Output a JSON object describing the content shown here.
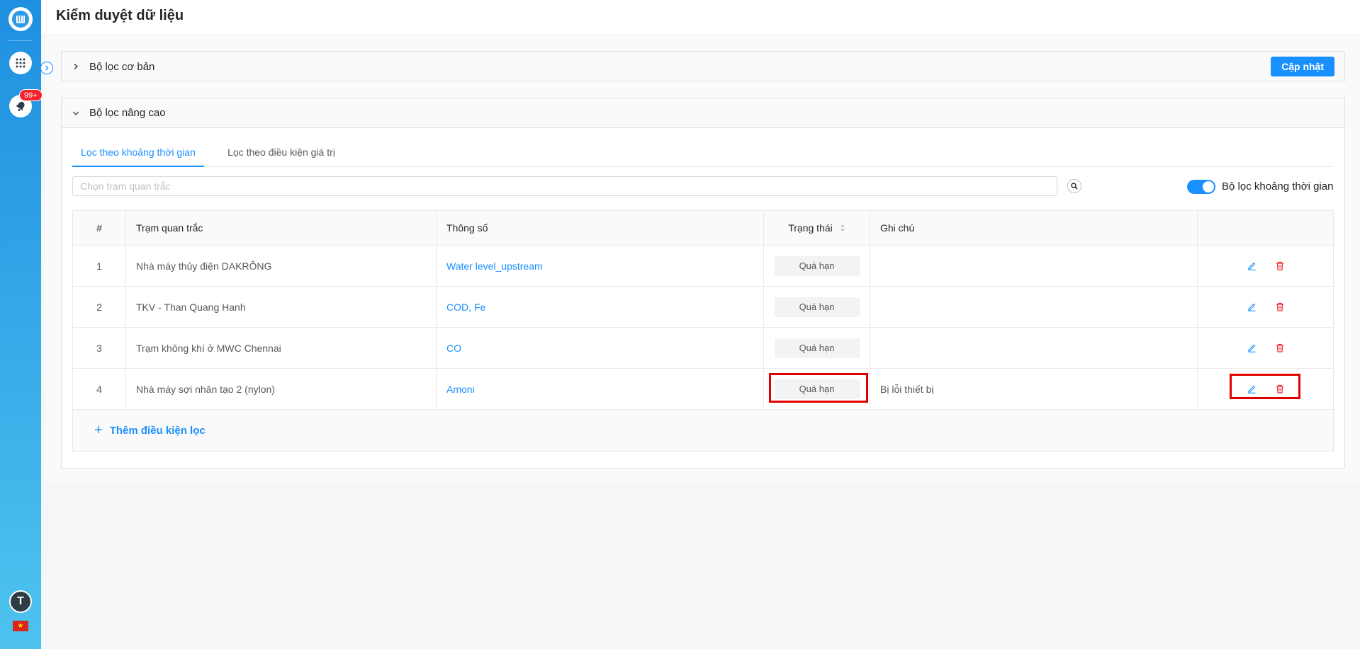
{
  "header": {
    "title": "Kiểm duyệt dữ liệu"
  },
  "sidebar": {
    "notification_count": "99+",
    "avatar_letter": "T"
  },
  "filters": {
    "basic_title": "Bộ lọc cơ bản",
    "update_label": "Cập nhật",
    "advanced_title": "Bộ lọc nâng cao",
    "tabs": [
      {
        "label": "Lọc theo khoảng thời gian",
        "active": true
      },
      {
        "label": "Lọc theo điều kiện giá trị",
        "active": false
      }
    ],
    "station_placeholder": "Chọn trạm quan trắc",
    "time_filter_label": "Bộ lọc khoảng thời gian",
    "time_filter_enabled": true
  },
  "table": {
    "columns": [
      "#",
      "Trạm quan trắc",
      "Thông số",
      "Trạng thái",
      "Ghi chú",
      ""
    ],
    "rows": [
      {
        "index": "1",
        "station": "Nhà máy thủy điện DAKRÔNG",
        "params": "Water level_upstream",
        "status": "Quá hạn",
        "note": ""
      },
      {
        "index": "2",
        "station": "TKV - Than Quang Hanh",
        "params": "COD, Fe",
        "status": "Quá hạn",
        "note": ""
      },
      {
        "index": "3",
        "station": "Trạm không khí ở MWC Chennai",
        "params": "CO",
        "status": "Quá hạn",
        "note": ""
      },
      {
        "index": "4",
        "station": "Nhà máy sợi nhân tạo 2 (nylon)",
        "params": "Amoni",
        "status": "Quá hạn",
        "note": "Bị lỗi thiết bị"
      }
    ],
    "add_condition_label": "Thêm điều kiện lọc"
  },
  "colors": {
    "primary": "#1890ff",
    "danger": "#f5222d",
    "highlight": "#e00000"
  }
}
